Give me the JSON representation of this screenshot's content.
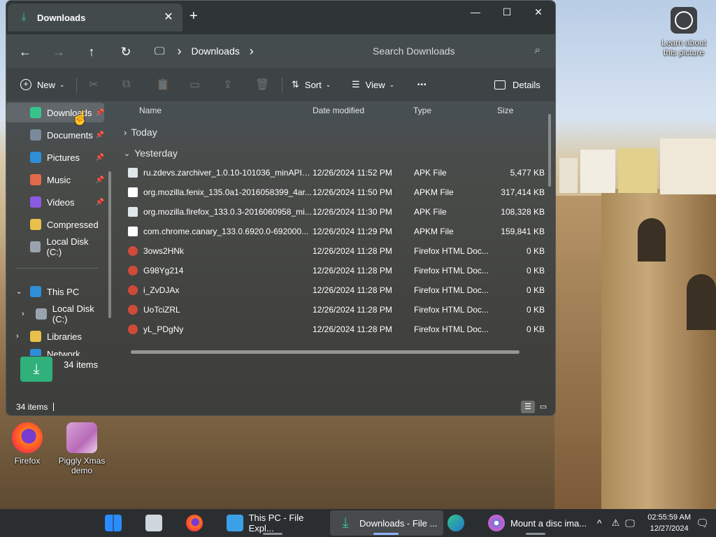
{
  "desktop": {
    "learn_label": "Learn about this picture",
    "icons": [
      {
        "label": "Firefox"
      },
      {
        "label": "Piggly Xmas demo"
      }
    ]
  },
  "window": {
    "tab_title": "Downloads",
    "tab_close": "✕",
    "new_tab": "+",
    "controls": {
      "minimize": "—",
      "maximize": "☐",
      "close": "✕"
    }
  },
  "address": {
    "back": "←",
    "forward": "→",
    "up": "↑",
    "refresh": "↻",
    "pc_icon": "🖵",
    "chevron": "›",
    "crumb": "Downloads",
    "search_placeholder": "Search Downloads",
    "search_icon": "⌕"
  },
  "toolbar": {
    "new_label": "New",
    "sort_label": "Sort",
    "view_label": "View",
    "more_label": "•••",
    "details_label": "Details"
  },
  "nav": {
    "items": [
      {
        "label": "Downloads",
        "icon": "downloads-icon",
        "color": "#36c48a",
        "pinned": true
      },
      {
        "label": "Documents",
        "icon": "documents-icon",
        "color": "#7a8a9a",
        "pinned": true
      },
      {
        "label": "Pictures",
        "icon": "pictures-icon",
        "color": "#2f8ed8",
        "pinned": true
      },
      {
        "label": "Music",
        "icon": "music-icon",
        "color": "#e06a4a",
        "pinned": true
      },
      {
        "label": "Videos",
        "icon": "videos-icon",
        "color": "#8a5ae0",
        "pinned": true
      },
      {
        "label": "Compressed",
        "icon": "folder-icon",
        "color": "#e8c04a",
        "pinned": false
      },
      {
        "label": "Local Disk (C:)",
        "icon": "drive-icon",
        "color": "#9aa4ae",
        "pinned": false
      }
    ],
    "tree": [
      {
        "label": "This PC"
      },
      {
        "label": "Local Disk (C:)"
      },
      {
        "label": "Libraries"
      },
      {
        "label": "Network"
      }
    ]
  },
  "list": {
    "columns": {
      "name": "Name",
      "date": "Date modified",
      "type": "Type",
      "size": "Size"
    },
    "groups": {
      "today": "Today",
      "yesterday": "Yesterday"
    },
    "rows": [
      {
        "name": "ru.zdevs.zarchiver_1.0.10-101036_minAPI1...",
        "date": "12/26/2024 11:52 PM",
        "type": "APK File",
        "size": "5,477 KB",
        "kind": "apk"
      },
      {
        "name": "org.mozilla.fenix_135.0a1-2016058399_4ar...",
        "date": "12/26/2024 11:50 PM",
        "type": "APKM File",
        "size": "317,414 KB",
        "kind": "apkm"
      },
      {
        "name": "org.mozilla.firefox_133.0.3-2016060958_mi...",
        "date": "12/26/2024 11:30 PM",
        "type": "APK File",
        "size": "108,328 KB",
        "kind": "apk"
      },
      {
        "name": "com.chrome.canary_133.0.6920.0-692000...",
        "date": "12/26/2024 11:29 PM",
        "type": "APKM File",
        "size": "159,841 KB",
        "kind": "apkm"
      },
      {
        "name": "3ows2HNk",
        "date": "12/26/2024 11:28 PM",
        "type": "Firefox HTML Doc...",
        "size": "0 KB",
        "kind": "html"
      },
      {
        "name": "G98Yg214",
        "date": "12/26/2024 11:28 PM",
        "type": "Firefox HTML Doc...",
        "size": "0 KB",
        "kind": "html"
      },
      {
        "name": "i_ZvDJAx",
        "date": "12/26/2024 11:28 PM",
        "type": "Firefox HTML Doc...",
        "size": "0 KB",
        "kind": "html"
      },
      {
        "name": "UoTciZRL",
        "date": "12/26/2024 11:28 PM",
        "type": "Firefox HTML Doc...",
        "size": "0 KB",
        "kind": "html"
      },
      {
        "name": "yL_PDgNy",
        "date": "12/26/2024 11:28 PM",
        "type": "Firefox HTML Doc...",
        "size": "0 KB",
        "kind": "html"
      }
    ]
  },
  "details_pane": {
    "count": "34 items"
  },
  "status": {
    "count": "34 items"
  },
  "taskbar": {
    "items": [
      {
        "label": "This PC - File Expl..."
      },
      {
        "label": "Downloads - File ..."
      },
      {
        "label": "Mount a disc ima..."
      }
    ],
    "time": "02:55:59 AM",
    "date": "12/27/2024",
    "tray_chevron": "^"
  },
  "colors": {
    "accent": "#36c48a",
    "taskbar": "#2b2e30"
  }
}
